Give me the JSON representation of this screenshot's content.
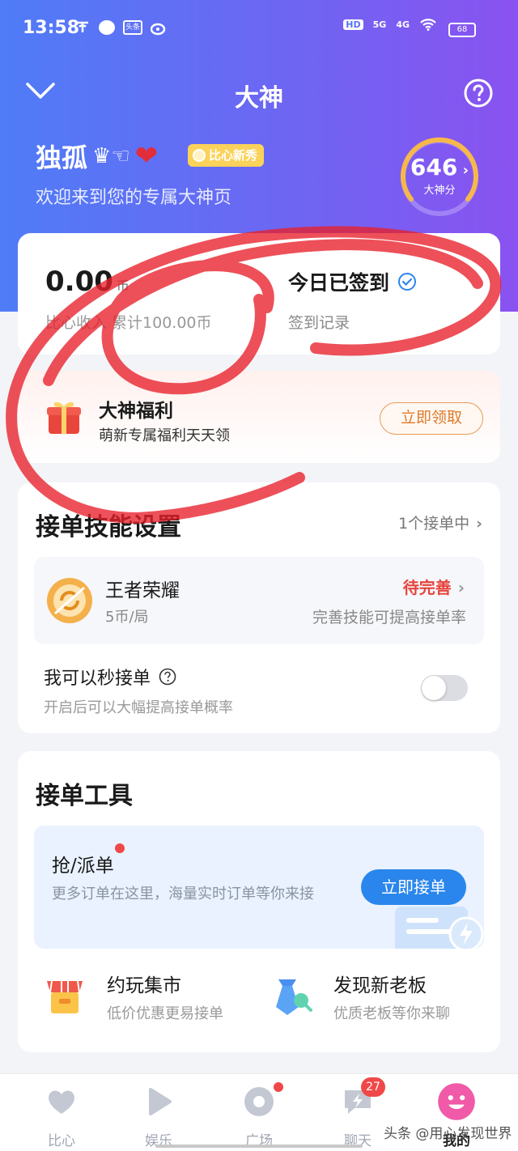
{
  "status_bar": {
    "time": "13:58",
    "left_icons": [
      "carrier-icon",
      "chat-icon",
      "toutiao-icon",
      "weibo-icon"
    ],
    "network_1": "HD",
    "network_2": "5G",
    "network_3": "4G",
    "battery": "68"
  },
  "nav": {
    "title": "大神",
    "back_icon": "chevron-down-icon",
    "help_icon": "question-circle-icon"
  },
  "profile": {
    "username": "独孤",
    "decor_emojis": "♛☜",
    "heart": "❤",
    "badge": "比心新秀",
    "welcome": "欢迎来到您的专属大神页",
    "score": "646",
    "score_label": "大神分"
  },
  "income": {
    "amount": "0.00",
    "unit": "币",
    "sub": "比心收入 累计100.00币",
    "sign_title": "今日已签到",
    "sign_sub": "签到记录"
  },
  "welfare": {
    "title": "大神福利",
    "sub": "萌新专属福利天天领",
    "button": "立即领取"
  },
  "skills": {
    "title": "接单技能设置",
    "right_text": "1个接单中",
    "game": {
      "name": "王者荣耀",
      "price": "5币/局",
      "status": "待完善",
      "tip": "完善技能可提高接单率"
    },
    "quick_accept": {
      "title": "我可以秒接单",
      "sub": "开启后可以大幅提高接单概率",
      "enabled": false
    }
  },
  "tools": {
    "title": "接单工具",
    "grab": {
      "title": "抢/派单",
      "sub": "更多订单在这里，海量实时订单等你来接",
      "button": "立即接单"
    },
    "items": [
      {
        "title": "约玩集市",
        "sub": "低价优惠更易接单",
        "icon": "shop-icon"
      },
      {
        "title": "发现新老板",
        "sub": "优质老板等你来聊",
        "icon": "tie-icon"
      }
    ]
  },
  "tabbar": {
    "tabs": [
      {
        "label": "比心",
        "icon": "heart-icon"
      },
      {
        "label": "娱乐",
        "icon": "play-icon"
      },
      {
        "label": "广场",
        "icon": "disc-icon"
      },
      {
        "label": "聊天",
        "icon": "chat-bubble-icon",
        "badge": "27"
      },
      {
        "label": "我的",
        "icon": "smile-face-icon"
      }
    ]
  },
  "watermark": "头条 @用心发现世界",
  "colors": {
    "hero_start": "#4f7cf7",
    "hero_end": "#8a52f0",
    "accent_blue": "#2a86ec",
    "warning_red": "#e5443d",
    "claim_orange": "#e07a2a",
    "active_tab": "#f05aa8"
  }
}
